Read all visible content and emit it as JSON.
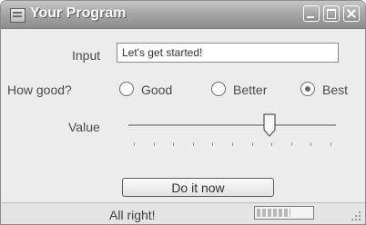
{
  "window": {
    "title": "Your Program",
    "controls": [
      "minimize-icon",
      "maximize-icon",
      "close-icon"
    ]
  },
  "form": {
    "input_label": "Input",
    "input_value": "Let's get started!",
    "how_good_label": "How good?",
    "options": [
      {
        "label": "Good",
        "selected": false
      },
      {
        "label": "Better",
        "selected": false
      },
      {
        "label": "Best",
        "selected": true
      }
    ],
    "value_label": "Value",
    "slider_value_fraction": 0.68,
    "tick_count": 11,
    "button_label": "Do it now"
  },
  "status": {
    "text": "All right!",
    "progress_fraction": 0.62
  }
}
